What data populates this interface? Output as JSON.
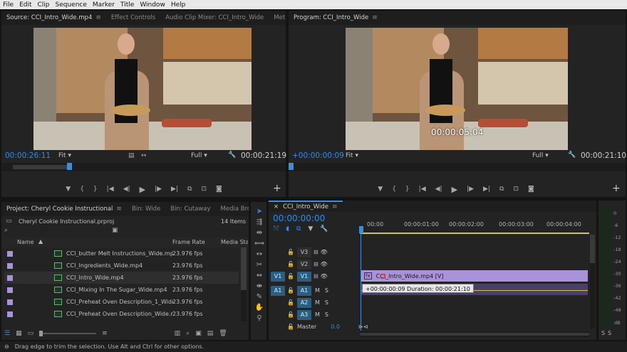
{
  "menu": [
    "File",
    "Edit",
    "Clip",
    "Sequence",
    "Marker",
    "Title",
    "Window",
    "Help"
  ],
  "source": {
    "tabs": [
      "Source: CCI_Intro_Wide.mp4",
      "Effect Controls",
      "Audio Clip Mixer: CCI_Intro_Wide",
      "Metadata"
    ],
    "timecode_left": "00:00:26:11",
    "fit": "Fit",
    "quality": "Full",
    "timecode_right": "00:00:21:19"
  },
  "program": {
    "tab": "Program: CCI_Intro_Wide",
    "overlay_timecode": "00:00:05:04",
    "timecode_left": "+00:00:00:09",
    "fit": "Fit",
    "quality": "Full",
    "timecode_right": "00:00:21:10"
  },
  "project": {
    "tabs": [
      "Project: Cheryl Cookie Instructional",
      "Bin: Wide",
      "Bin: Cutaway",
      "Media Browser"
    ],
    "file": "Cheryl Cookie Instructional.prproj",
    "count": "14 Items",
    "columns": [
      "Name",
      "Frame Rate",
      "Media Start"
    ],
    "rows": [
      {
        "name": "CCI_butter Melt Instructions_Wide.mp4",
        "fps": "23.976 fps"
      },
      {
        "name": "CCI_Ingredients_Wide.mp4",
        "fps": "23.976 fps"
      },
      {
        "name": "CCI_Intro_Wide.mp4",
        "fps": "23.976 fps"
      },
      {
        "name": "CCI_Mixing In The Sugar_Wide.mp4",
        "fps": "23.976 fps"
      },
      {
        "name": "CCI_Preheat Oven Description_1_Wide.m",
        "fps": "23.976 fps"
      },
      {
        "name": "CCI_Preheat Oven Description_Wide.mp4",
        "fps": "23.976 fps"
      }
    ]
  },
  "timeline": {
    "tab": "CCI_Intro_Wide",
    "timecode": "00:00:00:00",
    "ruler": [
      "00:00",
      "00:00:01:00",
      "00:00:02:00",
      "00:00:03:00",
      "00:00:04:00"
    ],
    "tracks": {
      "v3": "V3",
      "v2": "V2",
      "v1_src": "V1",
      "v1": "V1",
      "a1_src": "A1",
      "a1": "A1",
      "a2": "A2",
      "a3": "A3",
      "m": "M",
      "s": "S",
      "master": "Master",
      "master_val": "0.0"
    },
    "clip_name": "CCI_Intro_Wide.mp4 [V]",
    "clip_fx": "fx",
    "tooltip": "+00:00:00:09 Duration: 00:00:21:10"
  },
  "meter": {
    "labels": [
      "0",
      "-6",
      "-12",
      "-18",
      "-24",
      "-30",
      "-36",
      "-42",
      "-48",
      "dB"
    ],
    "solo": [
      "S",
      "S"
    ]
  },
  "status": "Drag edge to trim the selection. Use Alt and Ctrl for other options.",
  "colors": {
    "accent": "#2d8ceb",
    "clip": "#a992d9",
    "audio_clip": "#4a3f6b",
    "playhead": "#3a8fd6"
  }
}
